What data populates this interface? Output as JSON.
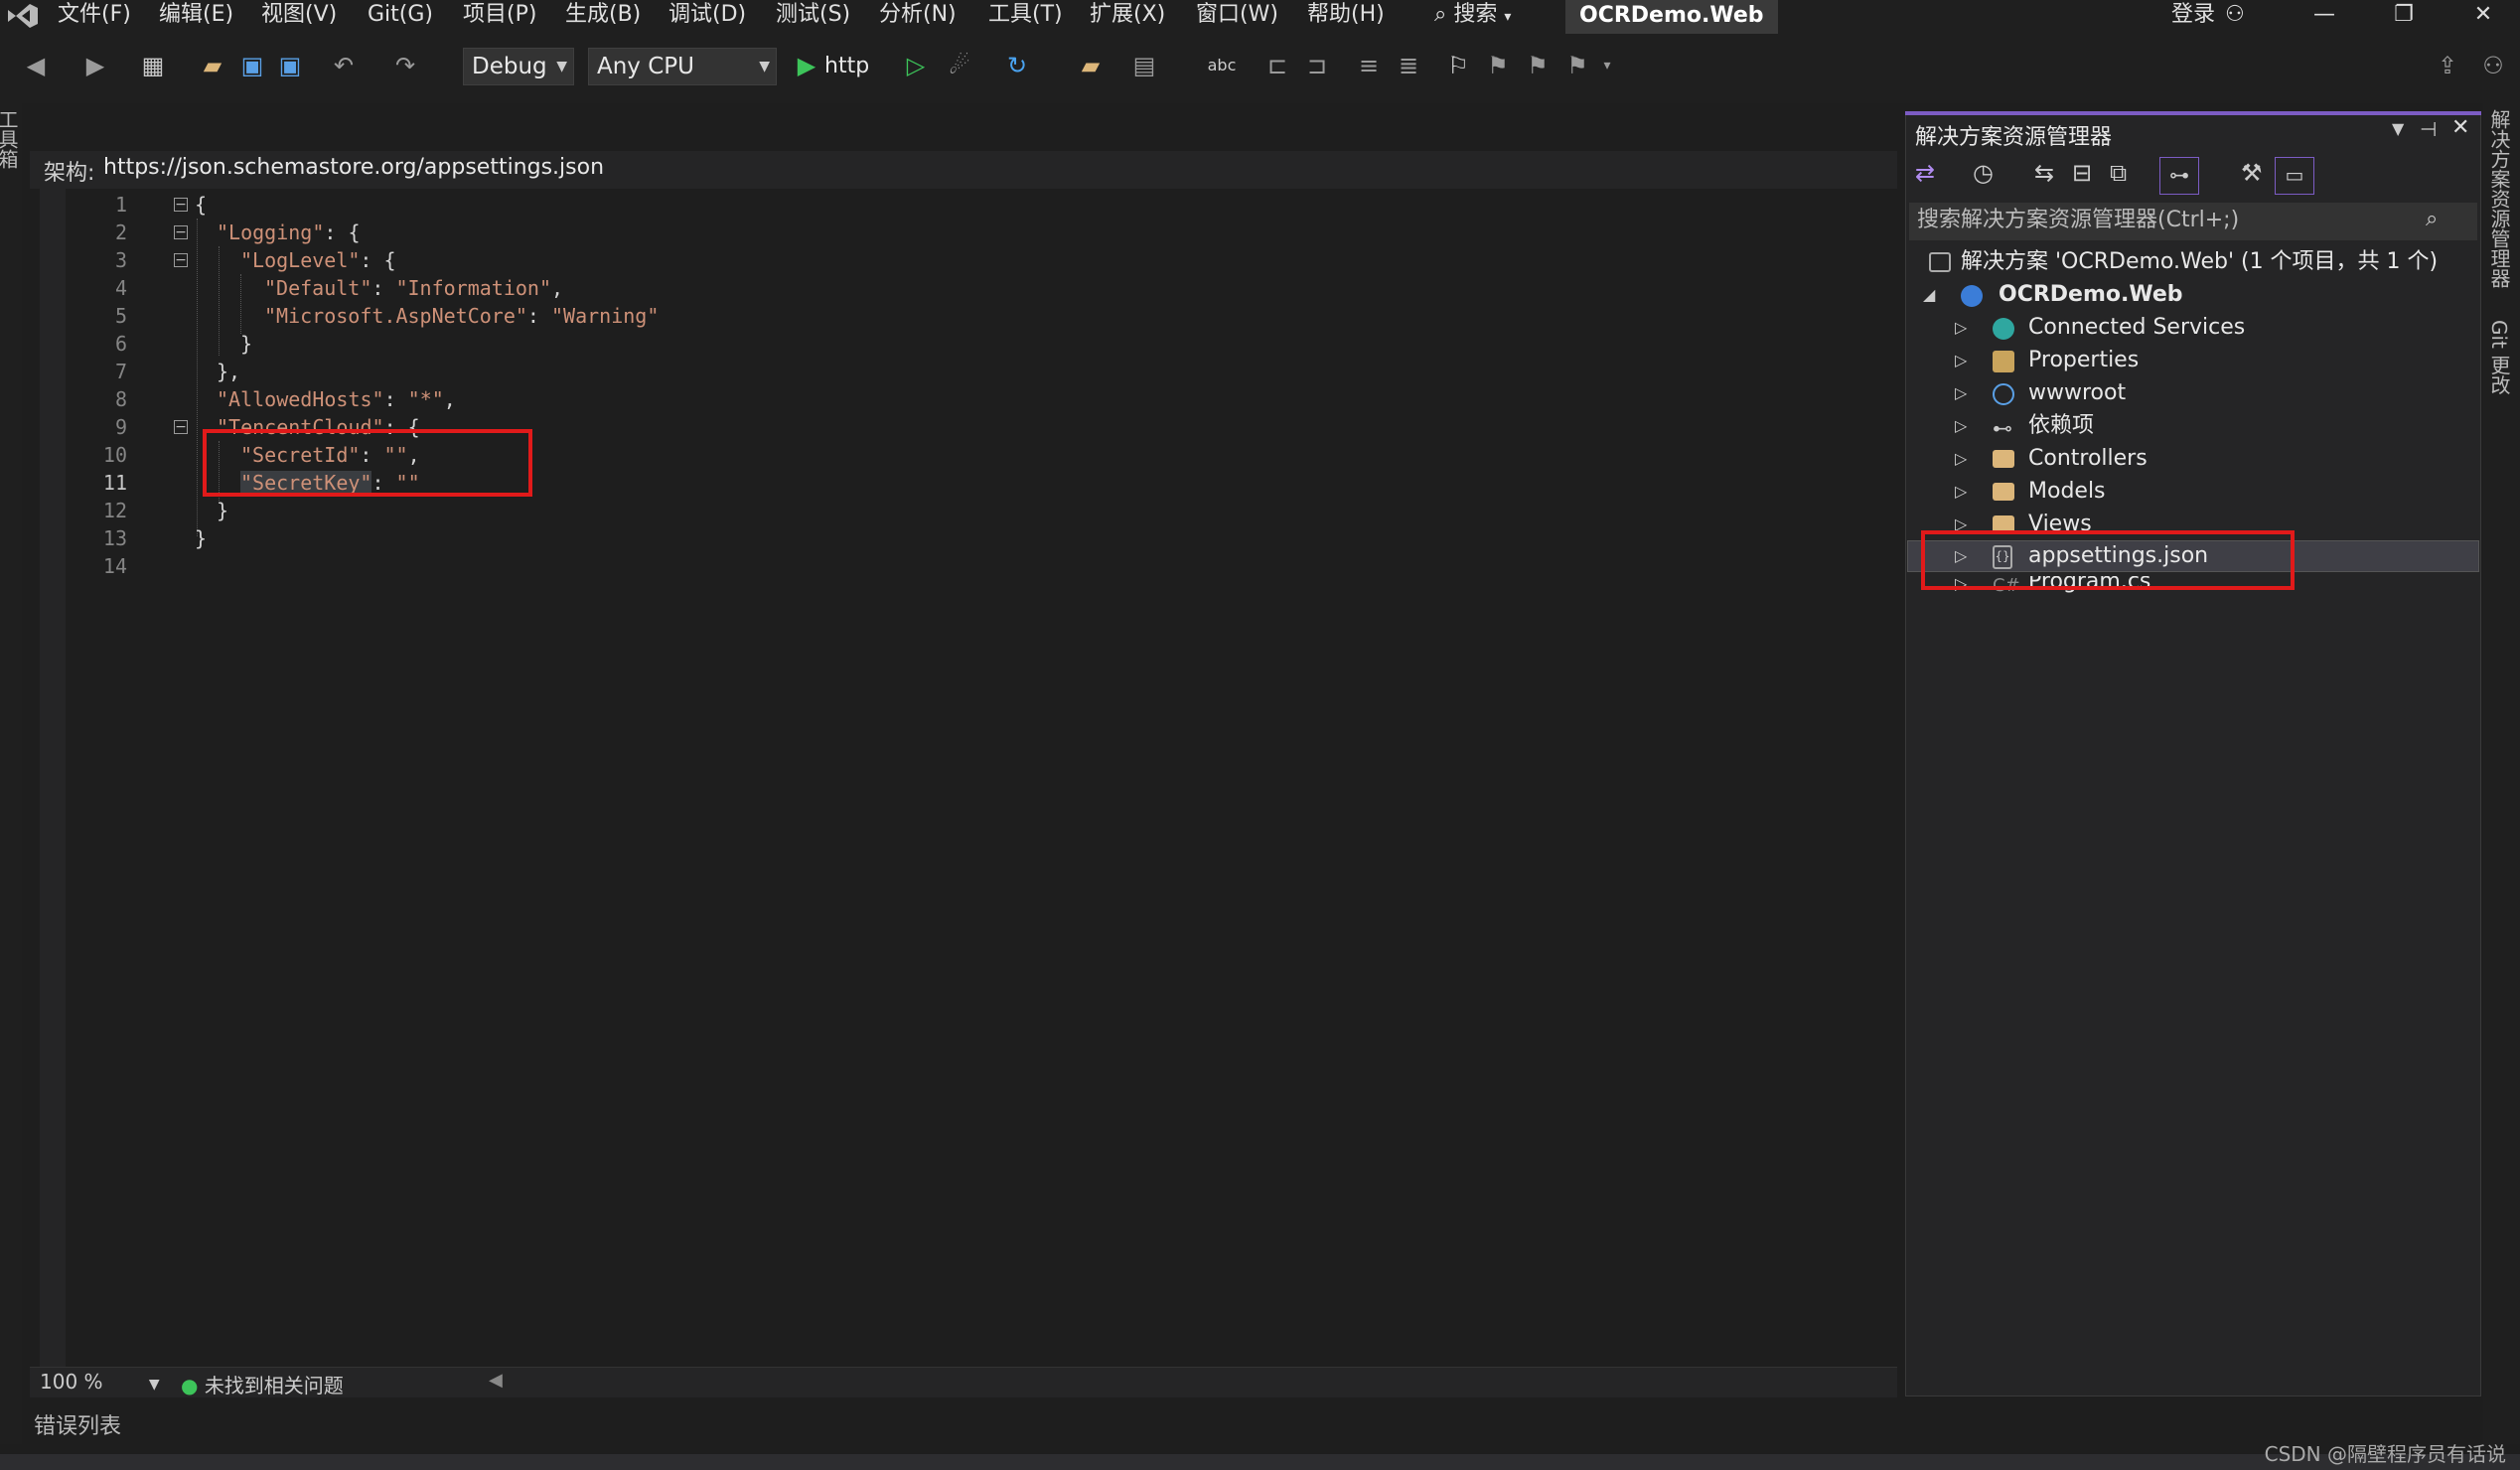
{
  "menu": {
    "items": [
      "文件(F)",
      "编辑(E)",
      "视图(V)",
      "Git(G)",
      "项目(P)",
      "生成(B)",
      "调试(D)",
      "测试(S)",
      "分析(N)",
      "工具(T)",
      "扩展(X)",
      "窗口(W)",
      "帮助(H)"
    ],
    "search_label": "搜索",
    "title": "OCRDemo.Web",
    "login": "登录"
  },
  "toolbar": {
    "config": "Debug",
    "platform": "Any CPU",
    "run_label": "http"
  },
  "left_tabs": {
    "toolbox": "工具箱"
  },
  "editor": {
    "schema_label": "架构:",
    "schema_url": "https://json.schemastore.org/appsettings.json",
    "line_numbers": [
      "1",
      "2",
      "3",
      "4",
      "5",
      "6",
      "7",
      "8",
      "9",
      "10",
      "11",
      "12",
      "13",
      "14"
    ],
    "code": {
      "l1": "{",
      "l2_key": "\"Logging\"",
      "l2_rest": ": {",
      "l3_key": "\"LogLevel\"",
      "l3_rest": ": {",
      "l4_key": "\"Default\"",
      "l4_sep": ": ",
      "l4_val": "\"Information\"",
      "l4_end": ",",
      "l5_key": "\"Microsoft.AspNetCore\"",
      "l5_sep": ": ",
      "l5_val": "\"Warning\"",
      "l6": "}",
      "l7": "},",
      "l8_key": "\"AllowedHosts\"",
      "l8_sep": ": ",
      "l8_val": "\"*\"",
      "l8_end": ",",
      "l9_key": "\"TencentCloud\"",
      "l9_rest": ": {",
      "l10_key": "\"SecretId\"",
      "l10_sep": ": ",
      "l10_val": "\"\"",
      "l10_end": ",",
      "l11_key": "\"SecretKey\"",
      "l11_sep": ": ",
      "l11_val": "\"\"",
      "l12": "}",
      "l13": "}"
    },
    "zoom": "100 %",
    "issues": "未找到相关问题"
  },
  "bottom": {
    "error_list": "错误列表",
    "watermark": "CSDN @隔壁程序员有话说"
  },
  "solution_explorer": {
    "title": "解决方案资源管理器",
    "search_placeholder": "搜索解决方案资源管理器(Ctrl+;)",
    "solution": "解决方案 'OCRDemo.Web' (1 个项目，共 1 个)",
    "project": "OCRDemo.Web",
    "items": [
      "Connected Services",
      "Properties",
      "wwwroot",
      "依赖项",
      "Controllers",
      "Models",
      "Views",
      "appsettings.json",
      "Program.cs"
    ]
  },
  "right_tabs": {
    "solution_explorer": "解决方案资源管理器",
    "git_changes": "Git 更改"
  },
  "colors": {
    "accent": "#7c5cc4",
    "highlight_box": "#e11a1a",
    "string": "#ce9178",
    "folder": "#dcb67a"
  }
}
